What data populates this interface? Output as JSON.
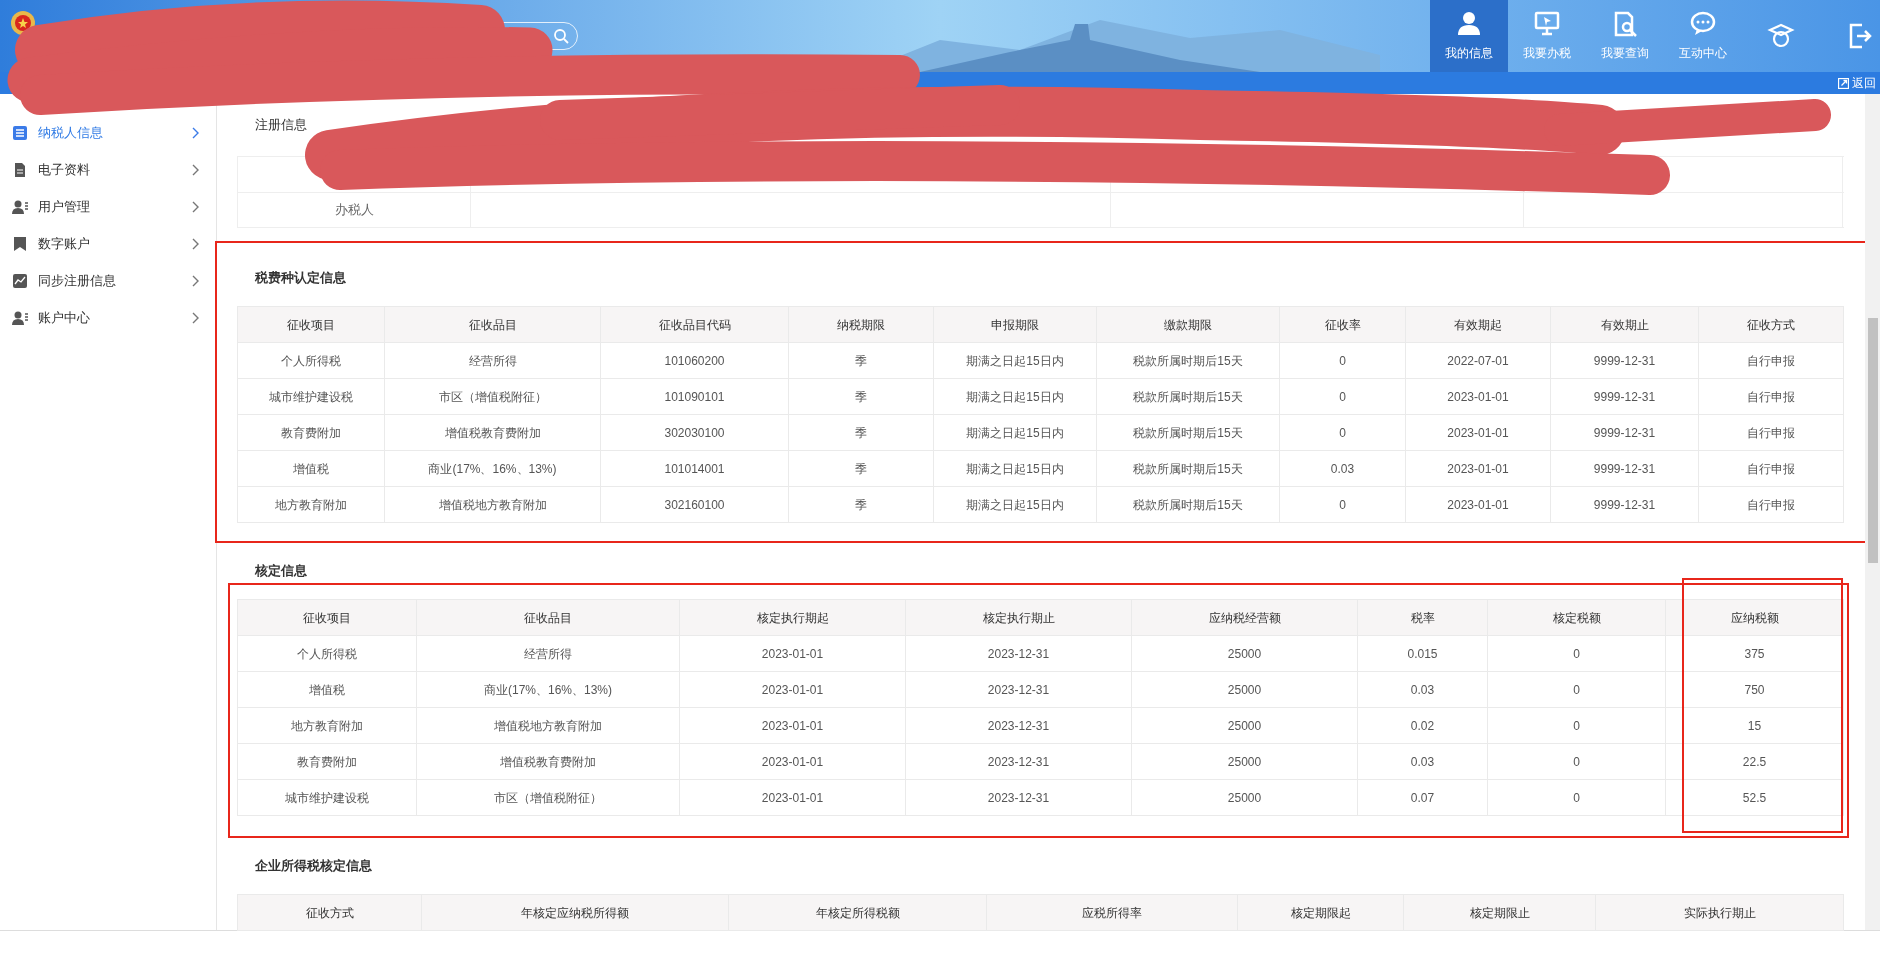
{
  "header": {
    "nav": [
      {
        "label": "我的信息",
        "selected": true
      },
      {
        "label": "我要办税",
        "selected": false
      },
      {
        "label": "我要查询",
        "selected": false
      },
      {
        "label": "互动中心",
        "selected": false
      },
      {
        "selected": false
      },
      {
        "selected": false
      }
    ],
    "back_link": "返回"
  },
  "sidebar": {
    "items": [
      {
        "label": "纳税人信息",
        "selected": true
      },
      {
        "label": "电子资料",
        "selected": false
      },
      {
        "label": "用户管理",
        "selected": false
      },
      {
        "label": "数字账户",
        "selected": false
      },
      {
        "label": "同步注册信息",
        "selected": false
      },
      {
        "label": "账户中心",
        "selected": false
      }
    ]
  },
  "registration": {
    "tab": "注册信息",
    "rows": [
      {
        "column_1": "办税人"
      }
    ]
  },
  "sections": [
    {
      "title": "税费种认定信息",
      "highlighted": true,
      "columns": [
        {
          "label": "征收项目",
          "highlighted": false
        },
        {
          "label": "征收品目",
          "highlighted": false
        },
        {
          "label": "征收品目代码",
          "highlighted": false
        },
        {
          "label": "纳税期限",
          "highlighted": false
        },
        {
          "label": "申报期限",
          "highlighted": false
        },
        {
          "label": "缴款期限",
          "highlighted": false
        },
        {
          "label": "征收率",
          "highlighted": false
        },
        {
          "label": "有效期起",
          "highlighted": false
        },
        {
          "label": "有效期止",
          "highlighted": false
        },
        {
          "label": "征收方式",
          "highlighted": false
        }
      ],
      "rows": [
        [
          "个人所得税",
          "经营所得",
          "101060200",
          "季",
          "期满之日起15日内",
          "税款所属时期后15天",
          "0",
          "2022-07-01",
          "9999-12-31",
          "自行申报"
        ],
        [
          "城市维护建设税",
          "市区（增值税附征）",
          "101090101",
          "季",
          "期满之日起15日内",
          "税款所属时期后15天",
          "0",
          "2023-01-01",
          "9999-12-31",
          "自行申报"
        ],
        [
          "教育费附加",
          "增值税教育费附加",
          "302030100",
          "季",
          "期满之日起15日内",
          "税款所属时期后15天",
          "0",
          "2023-01-01",
          "9999-12-31",
          "自行申报"
        ],
        [
          "增值税",
          "商业(17%、16%、13%)",
          "101014001",
          "季",
          "期满之日起15日内",
          "税款所属时期后15天",
          "0.03",
          "2023-01-01",
          "9999-12-31",
          "自行申报"
        ],
        [
          "地方教育附加",
          "增值税地方教育附加",
          "302160100",
          "季",
          "期满之日起15日内",
          "税款所属时期后15天",
          "0",
          "2023-01-01",
          "9999-12-31",
          "自行申报"
        ]
      ]
    },
    {
      "title": "核定信息",
      "highlighted": true,
      "columns": [
        {
          "label": "征收项目",
          "highlighted": false
        },
        {
          "label": "征收品目",
          "highlighted": false
        },
        {
          "label": "核定执行期起",
          "highlighted": false
        },
        {
          "label": "核定执行期止",
          "highlighted": false
        },
        {
          "label": "应纳税经营额",
          "highlighted": false
        },
        {
          "label": "税率",
          "highlighted": false
        },
        {
          "label": "核定税额",
          "highlighted": false
        },
        {
          "label": "应纳税额",
          "highlighted": true
        }
      ],
      "rows": [
        [
          "个人所得税",
          "经营所得",
          "2023-01-01",
          "2023-12-31",
          "25000",
          "0.015",
          "0",
          "375"
        ],
        [
          "增值税",
          "商业(17%、16%、13%)",
          "2023-01-01",
          "2023-12-31",
          "25000",
          "0.03",
          "0",
          "750"
        ],
        [
          "地方教育附加",
          "增值税地方教育附加",
          "2023-01-01",
          "2023-12-31",
          "25000",
          "0.02",
          "0",
          "15"
        ],
        [
          "教育费附加",
          "增值税教育费附加",
          "2023-01-01",
          "2023-12-31",
          "25000",
          "0.03",
          "0",
          "22.5"
        ],
        [
          "城市维护建设税",
          "市区（增值税附征）",
          "2023-01-01",
          "2023-12-31",
          "25000",
          "0.07",
          "0",
          "52.5"
        ]
      ]
    },
    {
      "title": "企业所得税核定信息",
      "highlighted": false,
      "columns": [
        {
          "label": "征收方式",
          "highlighted": false
        },
        {
          "label": "年核定应纳税所得额",
          "highlighted": false
        },
        {
          "label": "年核定所得税额",
          "highlighted": false
        },
        {
          "label": "应税所得率",
          "highlighted": false
        },
        {
          "label": "核定期限起",
          "highlighted": false
        },
        {
          "label": "核定期限止",
          "highlighted": false
        },
        {
          "label": "实际执行期止",
          "highlighted": false
        }
      ]
    }
  ]
}
